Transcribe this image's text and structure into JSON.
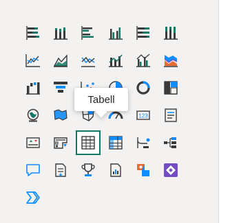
{
  "tooltip": {
    "text": "Tabell"
  },
  "colors": {
    "icon": "#3a3a3a",
    "blue": "#118dff",
    "teal": "#117865",
    "orange": "#e66c37",
    "purple": "#744ec2",
    "selected_border": "#117865"
  },
  "visuals": [
    {
      "icon": "stacked-bar-chart-icon"
    },
    {
      "icon": "stacked-column-chart-icon"
    },
    {
      "icon": "clustered-bar-chart-icon"
    },
    {
      "icon": "clustered-column-chart-icon"
    },
    {
      "icon": "100-percent-stacked-bar-chart-icon"
    },
    {
      "icon": "100-percent-stacked-column-chart-icon"
    },
    {
      "icon": "line-chart-icon"
    },
    {
      "icon": "area-chart-icon"
    },
    {
      "icon": "stacked-area-chart-icon"
    },
    {
      "icon": "line-and-stacked-column-chart-icon"
    },
    {
      "icon": "line-and-clustered-column-chart-icon"
    },
    {
      "icon": "ribbon-chart-icon"
    },
    {
      "icon": "waterfall-chart-icon"
    },
    {
      "icon": "funnel-chart-icon"
    },
    {
      "icon": "scatter-chart-icon"
    },
    {
      "icon": "pie-chart-icon"
    },
    {
      "icon": "donut-chart-icon"
    },
    {
      "icon": "treemap-icon"
    },
    {
      "icon": "map-icon"
    },
    {
      "icon": "filled-map-icon"
    },
    {
      "icon": "shape-map-icon"
    },
    {
      "icon": "gauge-icon"
    },
    {
      "icon": "card-icon"
    },
    {
      "icon": "multi-row-card-icon"
    },
    {
      "icon": "kpi-icon"
    },
    {
      "icon": "slicer-icon"
    },
    {
      "icon": "table-icon",
      "selected": true
    },
    {
      "icon": "matrix-icon"
    },
    {
      "icon": "key-influencers-icon"
    },
    {
      "icon": "decomposition-tree-icon"
    },
    {
      "icon": "qa-icon"
    },
    {
      "icon": "smart-narrative-icon"
    },
    {
      "icon": "metrics-icon"
    },
    {
      "icon": "paginated-report-icon"
    },
    {
      "icon": "azure-map-icon"
    },
    {
      "icon": "power-apps-icon"
    },
    {
      "icon": "power-automate-icon"
    }
  ]
}
